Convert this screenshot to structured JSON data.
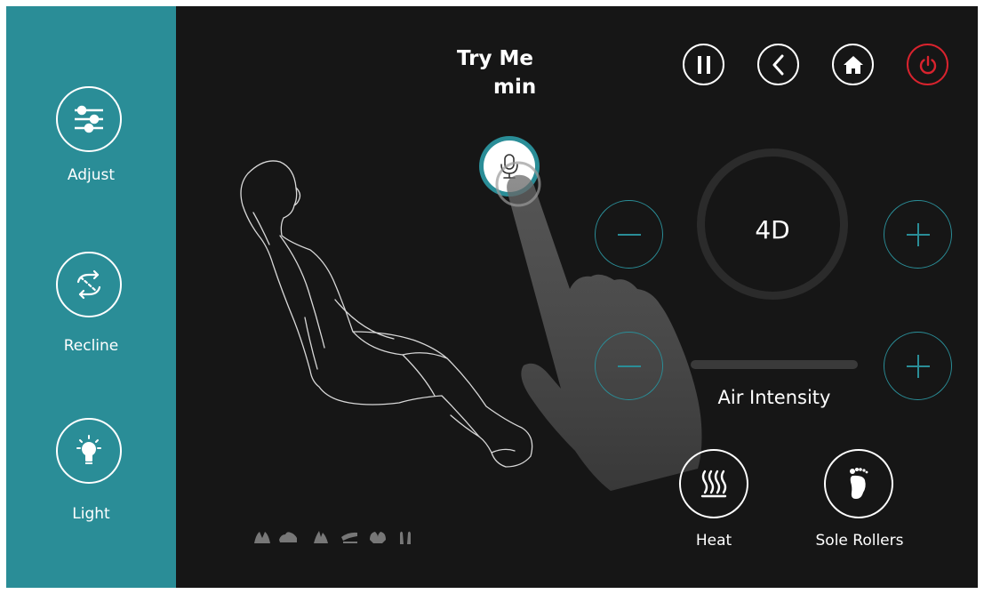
{
  "sidebar": {
    "items": [
      {
        "label": "Adjust",
        "icon": "sliders-icon"
      },
      {
        "label": "Recline",
        "icon": "recline-arrows-icon"
      },
      {
        "label": "Light",
        "icon": "lightbulb-icon"
      }
    ]
  },
  "header": {
    "title_line1": "Try Me",
    "title_line2": "min"
  },
  "top_buttons": [
    {
      "name": "pause",
      "icon": "pause-icon"
    },
    {
      "name": "back",
      "icon": "chevron-left-icon"
    },
    {
      "name": "home",
      "icon": "home-icon"
    },
    {
      "name": "power",
      "icon": "power-icon",
      "color": "#d9232e"
    }
  ],
  "mode": {
    "label": "4D"
  },
  "air": {
    "label": "Air Intensity",
    "level": 0
  },
  "features": [
    {
      "label": "Heat",
      "icon": "heat-waves-icon"
    },
    {
      "label": "Sole Rollers",
      "icon": "foot-icon"
    }
  ],
  "massage_icons": [
    "knead-icon",
    "tap-icon",
    "clap-icon",
    "roll-icon",
    "shiatsu-icon",
    "press-icon"
  ],
  "colors": {
    "accent": "#2a8d97",
    "background": "#161616",
    "power": "#d9232e"
  }
}
